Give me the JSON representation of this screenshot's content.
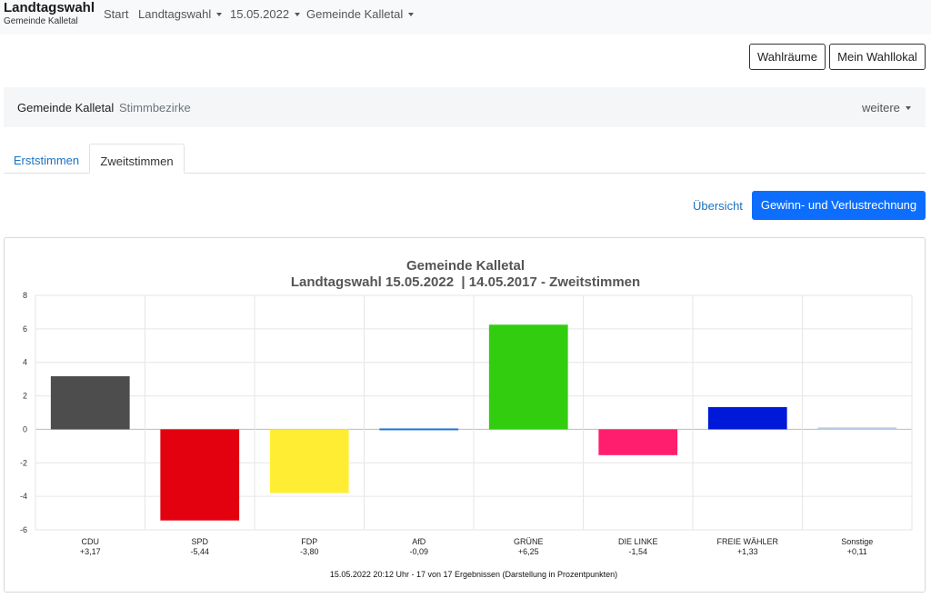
{
  "brand": {
    "title": "Landtagswahl",
    "subtitle": "Gemeinde Kalletal"
  },
  "topnav": {
    "start": "Start",
    "election": "Landtagswahl",
    "date": "15.05.2022",
    "municipality": "Gemeinde Kalletal"
  },
  "buttons": {
    "wahlraeume": "Wahlräume",
    "mein_wahllokal": "Mein Wahllokal"
  },
  "subnav": {
    "gemeinde": "Gemeinde Kalletal",
    "stimmbezirke": "Stimmbezirke",
    "weitere": "weitere"
  },
  "tabs": [
    {
      "label": "Erststimmen",
      "active": false
    },
    {
      "label": "Zweitstimmen",
      "active": true
    }
  ],
  "actions": {
    "uebersicht": "Übersicht",
    "gewinn_verlust": "Gewinn- und Verlustrechnung"
  },
  "chart_data": {
    "type": "bar",
    "title": "Gemeinde Kalletal",
    "subtitle": "Landtagswahl 15.05.2022  | 14.05.2017 - Zweitstimmen",
    "categories": [
      "CDU",
      "SPD",
      "FDP",
      "AfD",
      "GRÜNE",
      "DIE LINKE",
      "FREIE WÄHLER",
      "Sonstige"
    ],
    "value_labels": [
      "+3,17",
      "-5,44",
      "-3,80",
      "-0,09",
      "+6,25",
      "-1,54",
      "+1,33",
      "+0,11"
    ],
    "values": [
      3.17,
      -5.44,
      -3.8,
      -0.09,
      6.25,
      -1.54,
      1.33,
      0.11
    ],
    "colors": [
      "#4d4d4d",
      "#e3000f",
      "#ffed34",
      "#1f77d4",
      "#32cd0f",
      "#ff1e6e",
      "#0019d9",
      "#b7c8e3"
    ],
    "ylim": [
      -6,
      8
    ],
    "yticks": [
      "-6",
      "-4",
      "-2",
      "0",
      "2",
      "4",
      "6",
      "8"
    ],
    "grid": true,
    "footnote": "15.05.2022 20:12 Uhr - 17 von 17 Ergebnissen (Darstellung in Prozentpunkten)"
  }
}
